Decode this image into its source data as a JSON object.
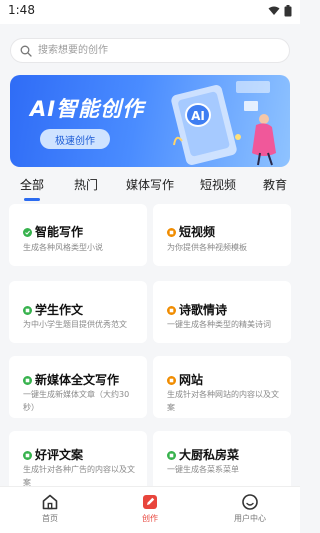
{
  "status": {
    "time": "1:48"
  },
  "search": {
    "placeholder": "搜索想要的创作"
  },
  "banner": {
    "title": "AI智能创作",
    "button": "极速创作",
    "art_badge": "AI"
  },
  "tabs": [
    {
      "label": "全部",
      "active": true
    },
    {
      "label": "热门"
    },
    {
      "label": "媒体写作"
    },
    {
      "label": "短视频"
    },
    {
      "label": "教育"
    }
  ],
  "cards": [
    {
      "title": "智能写作",
      "desc": "生成各种风格类型小说",
      "icon": "green-dot-icon",
      "color": "#37b24d"
    },
    {
      "title": "短视频",
      "desc": "为你提供各种视频模板",
      "icon": "orange-dot-icon",
      "color": "#f08c00"
    },
    {
      "title": "学生作文",
      "desc": "为中小学生题目提供优秀范文",
      "icon": "green-dot-icon",
      "color": "#37b24d"
    },
    {
      "title": "诗歌情诗",
      "desc": "一键生成各种类型的精美诗词",
      "icon": "orange-dot-icon",
      "color": "#f08c00"
    },
    {
      "title": "新媒体全文写作",
      "desc": "一键生成新媒体文章（大约30秒）",
      "icon": "green-dot-icon",
      "color": "#37b24d"
    },
    {
      "title": "网站",
      "desc": "生成针对各种网站的内容以及文案",
      "icon": "orange-dot-icon",
      "color": "#f08c00"
    },
    {
      "title": "好评文案",
      "desc": "生成针对各种广告的内容以及文案",
      "icon": "green-dot-icon",
      "color": "#37b24d"
    },
    {
      "title": "大厨私房菜",
      "desc": "一键生成各菜系菜单",
      "icon": "green-dot-icon",
      "color": "#37b24d"
    }
  ],
  "bottom_nav": [
    {
      "label": "首页",
      "icon": "home-icon"
    },
    {
      "label": "创作",
      "icon": "create-icon",
      "active": true
    },
    {
      "label": "用户中心",
      "icon": "user-smile-icon"
    }
  ],
  "colors": {
    "accent": "#2b6bf0",
    "nav_active": "#e8453c"
  }
}
